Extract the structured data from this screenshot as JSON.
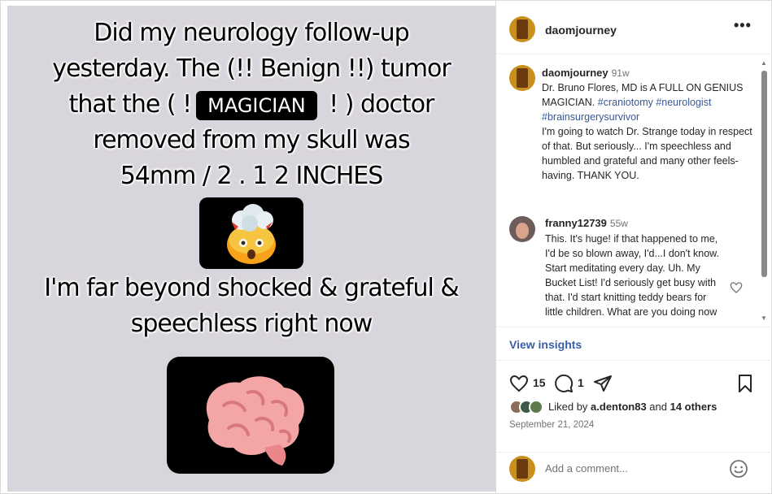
{
  "post": {
    "caption_lines_top": [
      "Did my neurology follow-up",
      "yesterday. The (!! Benign !!)  tumor"
    ],
    "caption_line3_before": "that the ( !",
    "caption_line3_tag": "MAGICIAN",
    "caption_line3_after": " ! ) doctor",
    "caption_lines_mid": [
      "removed from my skull was",
      "54mm / 2 . 1 2 INCHES"
    ],
    "caption_lines_bottom": [
      "I'm far beyond shocked & grateful &",
      "speechless right now"
    ]
  },
  "header": {
    "username": "daomjourney",
    "more_label": "•••"
  },
  "caption": {
    "username": "daomjourney",
    "time": "91w",
    "text_before": "Dr. Bruno Flores, MD is A FULL ON GENIUS MAGICIAN. ",
    "tags": "#craniotomy #neurologist #brainsurgerysurvivor",
    "text_after": "I'm going to watch Dr. Strange today in respect of that. But seriously... I'm speechless and humbled and grateful and many other feels-having. THANK YOU."
  },
  "comment": {
    "username": "franny12739",
    "time": "55w",
    "text": "This. It's huge! if that happened to me, I'd be so blown away, I'd...I don't know. Start meditating every day. Uh. My Bucket List! I'd seriously get busy with that. I'd start knitting teddy bears for little children. What are you doing now"
  },
  "insights_label": "View insights",
  "actions": {
    "like_count": "15",
    "comment_count": "1"
  },
  "likes": {
    "prefix": "Liked by ",
    "user": "a.denton83",
    "middle": " and ",
    "others": "14 others"
  },
  "date": "September 21, 2024",
  "compose": {
    "placeholder": "Add a comment..."
  },
  "colors": {
    "media_bg": "#d9d5dc",
    "link": "#3b5ea8",
    "hashtag": "#385898",
    "avatar": "#c9901e"
  }
}
